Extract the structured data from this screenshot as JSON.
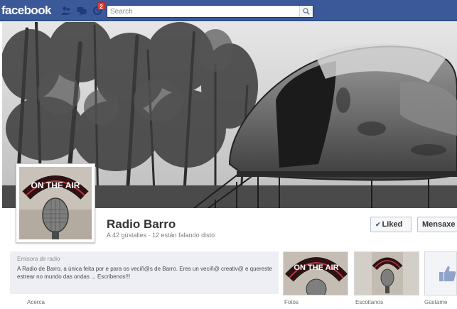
{
  "topbar": {
    "logo": "facebook",
    "notifications_count": "2",
    "search_placeholder": "Search",
    "icons": [
      "friend-requests-icon",
      "messages-icon",
      "notifications-icon",
      "search-icon"
    ],
    "color": "#3b5998"
  },
  "cover": {
    "description_icon": "cover-photo"
  },
  "profile": {
    "sign_text": "ON THE AIR"
  },
  "page": {
    "name": "Radio Barro",
    "stats": "A 42 gústalles · 12 están falando disto"
  },
  "actions": {
    "liked_label": "Liked",
    "message_label": "Mensaxe"
  },
  "about": {
    "category": "Emisora de radio",
    "description": "A Radio de Barro, a única feita por e para os veciñ@s de Barro. Eres un veciñ@ creativ@ e quereste estrear no mundo das ondas ... Escribenos!!!"
  },
  "tabs": {
    "about": "Acerca",
    "photos": "Fotos",
    "listeners": "Escoitanos",
    "likes": "Gústame"
  }
}
